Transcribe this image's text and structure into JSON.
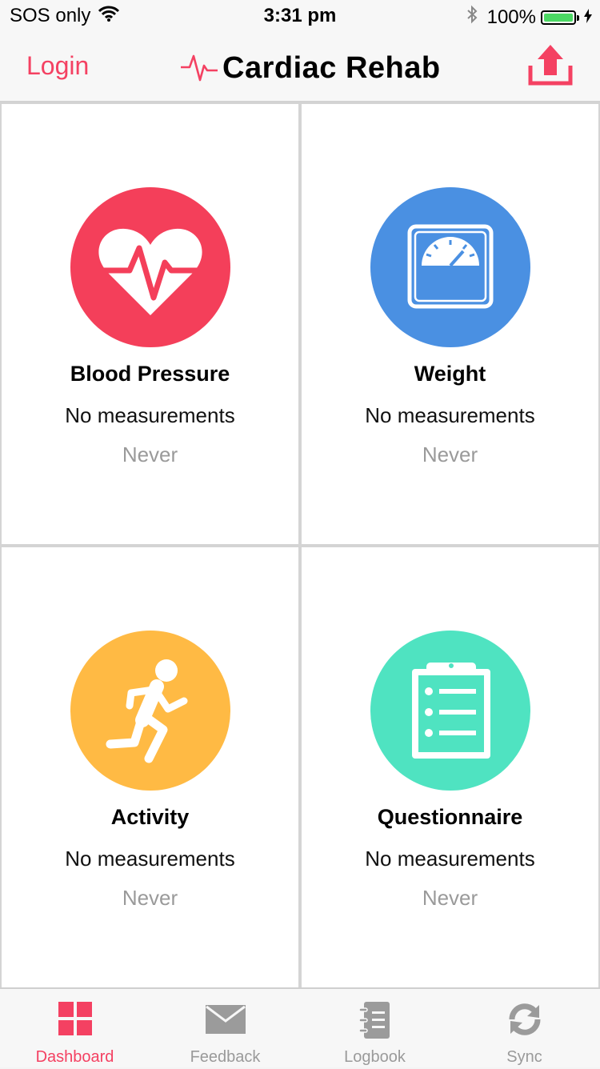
{
  "status_bar": {
    "carrier": "SOS only",
    "time": "3:31 pm",
    "battery": "100%",
    "icons": [
      "wifi-icon",
      "bluetooth-icon",
      "battery-icon",
      "charging-icon"
    ]
  },
  "nav": {
    "login_label": "Login",
    "title": "Cardiac Rehab",
    "logo_icon": "heartbeat-line-icon",
    "upload_icon": "upload-icon"
  },
  "colors": {
    "accent": "#f44162",
    "blood_pressure": "#f43f5a",
    "weight": "#4a90e2",
    "activity": "#ffba44",
    "questionnaire": "#4fe3c1",
    "muted": "#9a9a9a"
  },
  "tiles": [
    {
      "title": "Blood Pressure",
      "subtitle": "No measurements",
      "last": "Never",
      "icon": "heart-pulse-icon"
    },
    {
      "title": "Weight",
      "subtitle": "No measurements",
      "last": "Never",
      "icon": "scale-icon"
    },
    {
      "title": "Activity",
      "subtitle": "No measurements",
      "last": "Never",
      "icon": "running-person-icon"
    },
    {
      "title": "Questionnaire",
      "subtitle": "No measurements",
      "last": "Never",
      "icon": "clipboard-icon"
    }
  ],
  "tabs": [
    {
      "label": "Dashboard",
      "icon": "grid-icon",
      "active": true
    },
    {
      "label": "Feedback",
      "icon": "envelope-icon",
      "active": false
    },
    {
      "label": "Logbook",
      "icon": "notebook-icon",
      "active": false
    },
    {
      "label": "Sync",
      "icon": "sync-icon",
      "active": false
    }
  ]
}
